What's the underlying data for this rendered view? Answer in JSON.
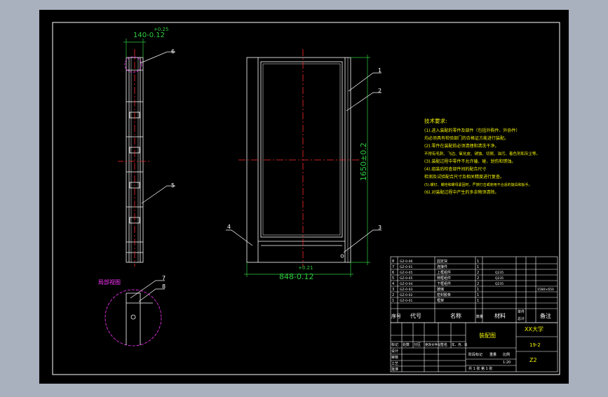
{
  "colors": {
    "background": "#a9b1bf",
    "sheet": "#000000",
    "line": "#ffffff",
    "centerline": "#ff2a2a",
    "dimension": "#2ecc40",
    "notes": "#f2f200",
    "detail_circle": "#ff33ff",
    "title_text": "#f2f200"
  },
  "dimensions": {
    "side_width_tol": "+0.25",
    "side_width": "140-0.12",
    "front_height": "1650±0.2",
    "front_width_tol": "+0.21",
    "front_width": "848-0.12"
  },
  "balloons": [
    "1",
    "2",
    "3",
    "4",
    "5",
    "6",
    "7",
    "8"
  ],
  "detail_label": "局部视图",
  "tech_notes": {
    "title": "技术要求:",
    "lines": [
      "(1).进入装配的零件及部件（包括外购件、外协件）",
      "均必须具有检验部门的合格证方能进行装配。",
      "(2).零件在装配前必须清理和清洗干净，",
      "不得有毛刺、飞边、氧化皮、锈蚀、切屑、油污、着色剂和灰尘等。",
      "(3).装配过程中零件不允许磕、碰、划伤和锈蚀。",
      "(4).组装后检查部件间的配合尺寸",
      "检测及试验配合尺寸及相关精度进行复查。",
      "(5).螺钉、螺栓和螺母紧固时，严禁打击或使用不合适的旋具和扳手。",
      "(6).对装配过程中产生的多余物须清除。"
    ]
  },
  "parts": [
    {
      "no": "8",
      "code": "GZ-0-06",
      "name": "固定块",
      "qty": "1",
      "material": "",
      "note": ""
    },
    {
      "no": "7",
      "code": "GZ-0-01",
      "name": "连接件",
      "qty": "1",
      "material": "",
      "note": ""
    },
    {
      "no": "6",
      "code": "GZ-0-05",
      "name": "上框组件",
      "qty": "2",
      "material": "Q235",
      "note": ""
    },
    {
      "no": "5",
      "code": "GZ-0-05",
      "name": "侧框组件",
      "qty": "2",
      "material": "Q235",
      "note": ""
    },
    {
      "no": "4",
      "code": "GZ-0-04",
      "name": "下框组件",
      "qty": "2",
      "material": "Q235",
      "note": ""
    },
    {
      "no": "3",
      "code": "GZ-0-03",
      "name": "玻璃",
      "qty": "1",
      "material": "",
      "note": "1580×650"
    },
    {
      "no": "2",
      "code": "GZ-0-02",
      "name": "密封胶条",
      "qty": "1",
      "material": "",
      "note": ""
    },
    {
      "no": "1",
      "code": "GZ-0-01",
      "name": "框架",
      "qty": "1",
      "material": "",
      "note": ""
    }
  ],
  "parts_header": [
    "序号",
    "代号",
    "名称",
    "数量",
    "材料",
    "单件",
    "总计",
    "备注"
  ],
  "title_block": {
    "drawing_name": "装配图",
    "school": "XX大学",
    "drawing_no": "19-2",
    "scale_code": "Z2",
    "row_labels": [
      "标记",
      "处数",
      "分区",
      "更改文件号",
      "签名",
      "年、月、日"
    ],
    "left_labels": [
      "设计",
      "审核",
      "工艺",
      "批准"
    ],
    "stage_label": "阶段标记",
    "weight_label": "重量",
    "ratio_label": "比例",
    "ratio_value": "1:20",
    "sheet_text": "共  1  张    第  1  张"
  }
}
